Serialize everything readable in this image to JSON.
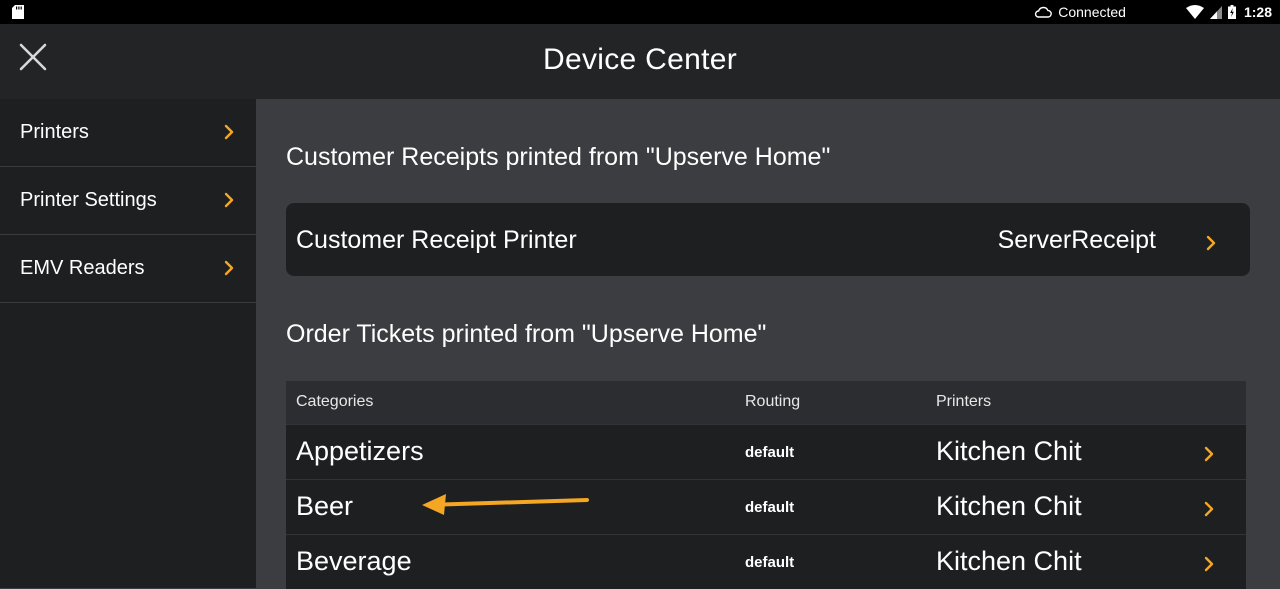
{
  "status_bar": {
    "connection": "Connected",
    "time": "1:28",
    "icons": [
      "sd-card-icon",
      "cloud-icon",
      "wifi-icon",
      "signal-icon",
      "battery-icon"
    ]
  },
  "header": {
    "title": "Device Center",
    "close_icon": "close-icon"
  },
  "sidebar": {
    "items": [
      {
        "label": "Printers"
      },
      {
        "label": "Printer Settings"
      },
      {
        "label": "EMV Readers"
      }
    ]
  },
  "receipts": {
    "section_title": "Customer Receipts printed from \"Upserve Home\"",
    "printer_label": "Customer Receipt Printer",
    "printer_value": "ServerReceipt"
  },
  "tickets": {
    "section_title": "Order Tickets printed from \"Upserve Home\"",
    "columns": [
      "Categories",
      "Routing",
      "Printers"
    ],
    "rows": [
      {
        "category": "Appetizers",
        "routing": "default",
        "printer": "Kitchen Chit"
      },
      {
        "category": "Beer",
        "routing": "default",
        "printer": "Kitchen Chit"
      },
      {
        "category": "Beverage",
        "routing": "default",
        "printer": "Kitchen Chit"
      }
    ]
  },
  "colors": {
    "accent": "#f5a623",
    "background": "#3c3d40",
    "header": "#232426",
    "panel": "#1e1f21"
  }
}
